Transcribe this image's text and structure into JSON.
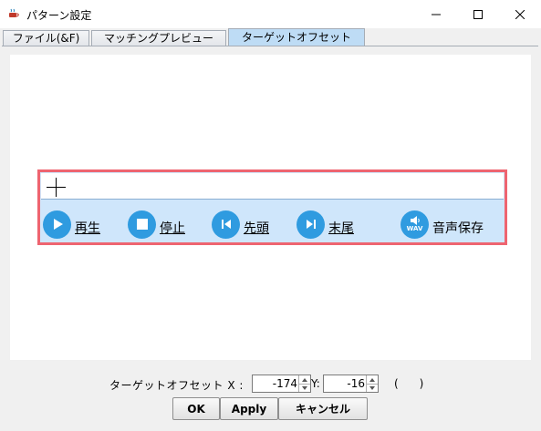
{
  "window": {
    "title": "パターン設定",
    "icon": "java-cup-icon"
  },
  "tabs": [
    {
      "label": "ファイル(&F)",
      "active": false
    },
    {
      "label": "マッチングプレビュー",
      "active": false
    },
    {
      "label": "ターゲットオフセット",
      "active": true
    }
  ],
  "player": {
    "controls": [
      {
        "label": "再生",
        "icon": "play-icon"
      },
      {
        "label": "停止",
        "icon": "stop-icon"
      },
      {
        "label": "先頭",
        "icon": "skip-to-start-icon"
      },
      {
        "label": "末尾",
        "icon": "skip-to-end-icon"
      },
      {
        "label": "音声保存",
        "icon": "wav-save-icon",
        "icon_text": "WAV"
      }
    ],
    "highlight_color": "#ee6470",
    "accent_color": "#2f9be0"
  },
  "offset": {
    "label": "ターゲットオフセット X :",
    "x_value": "-174",
    "y_label": "Y:",
    "y_value": "-16",
    "parens": "(      )"
  },
  "buttons": {
    "ok": "OK",
    "apply": "Apply",
    "cancel": "キャンセル"
  }
}
